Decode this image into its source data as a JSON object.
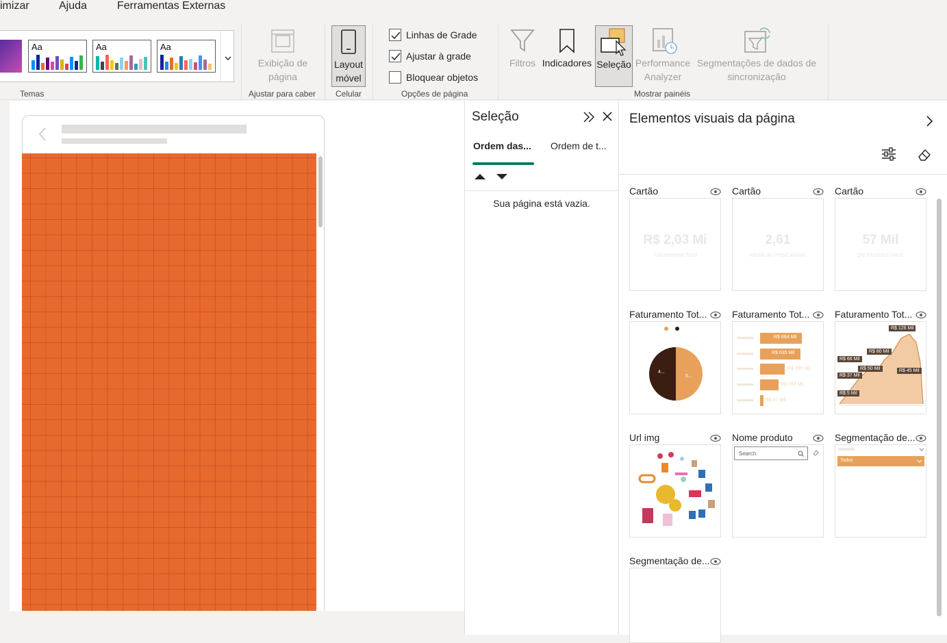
{
  "menu": {
    "items": [
      "imizar",
      "Ajuda",
      "Ferramentas Externas"
    ]
  },
  "ribbon": {
    "themes_label": "Temas",
    "theme_aa": "Aa",
    "page_view_label": "Exibição de página",
    "fit_label": "Ajustar para caber",
    "mobile_layout_label": "Layout móvel",
    "phone_label": "Celular",
    "gridlines_label": "Linhas de Grade",
    "snap_label": "Ajustar à grade",
    "lock_label": "Bloquear objetos",
    "page_options_label": "Opções de página",
    "filters_label": "Filtros",
    "bookmarks_label": "Indicadores",
    "selection_label": "Seleção",
    "performance_label": "Performance Analyzer",
    "sync_label": "Segmentações de dados de sincronização",
    "show_panes_label": "Mostrar painéis",
    "gridlines_checked": true,
    "snap_checked": true,
    "lock_checked": false
  },
  "selection_pane": {
    "title": "Seleção",
    "tab_layer": "Ordem das...",
    "tab_tab": "Ordem de t...",
    "empty_text": "Sua página está vazia."
  },
  "visuals_pane": {
    "title": "Elementos visuais da página",
    "tiles": [
      {
        "title": "Cartão",
        "value": "R$ 2,03 Mi",
        "subtitle": "Faturamento Total"
      },
      {
        "title": "Cartão",
        "value": "2,61",
        "subtitle": "Média de Pets/Clientes"
      },
      {
        "title": "Cartão",
        "value": "57 Mil",
        "subtitle": "Qtd Produtos Vend."
      },
      {
        "title": "Faturamento Tot..."
      },
      {
        "title": "Faturamento Tot..."
      },
      {
        "title": "Faturamento Tot..."
      },
      {
        "title": "Url img"
      },
      {
        "title": "Nome produto"
      },
      {
        "title": "Segmentação de..."
      },
      {
        "title": "Segmentação de..."
      }
    ],
    "pie": {
      "left": "4...",
      "right": "5..."
    },
    "bar_labels": [
      "R$ 664 Mil",
      "R$ 635 Mil",
      "R$ 390 Mil",
      "R$ 293 Mil",
      "R$ 47 Mil"
    ],
    "area_labels": [
      "R$ 126 Mil",
      "R$ 80 Mil",
      "R$ 66 Mil",
      "R$ 50 Mil",
      "R$ 45 Mil",
      "R$ 37 Mil",
      "R$ 5 Mil"
    ],
    "search_placeholder": "Search",
    "slicer_value": "Todos"
  },
  "colors": {
    "accent": "#e8692e",
    "tab_underline": "#117865",
    "chart_orange": "#e8a15a",
    "chart_dark": "#3b1d12"
  }
}
